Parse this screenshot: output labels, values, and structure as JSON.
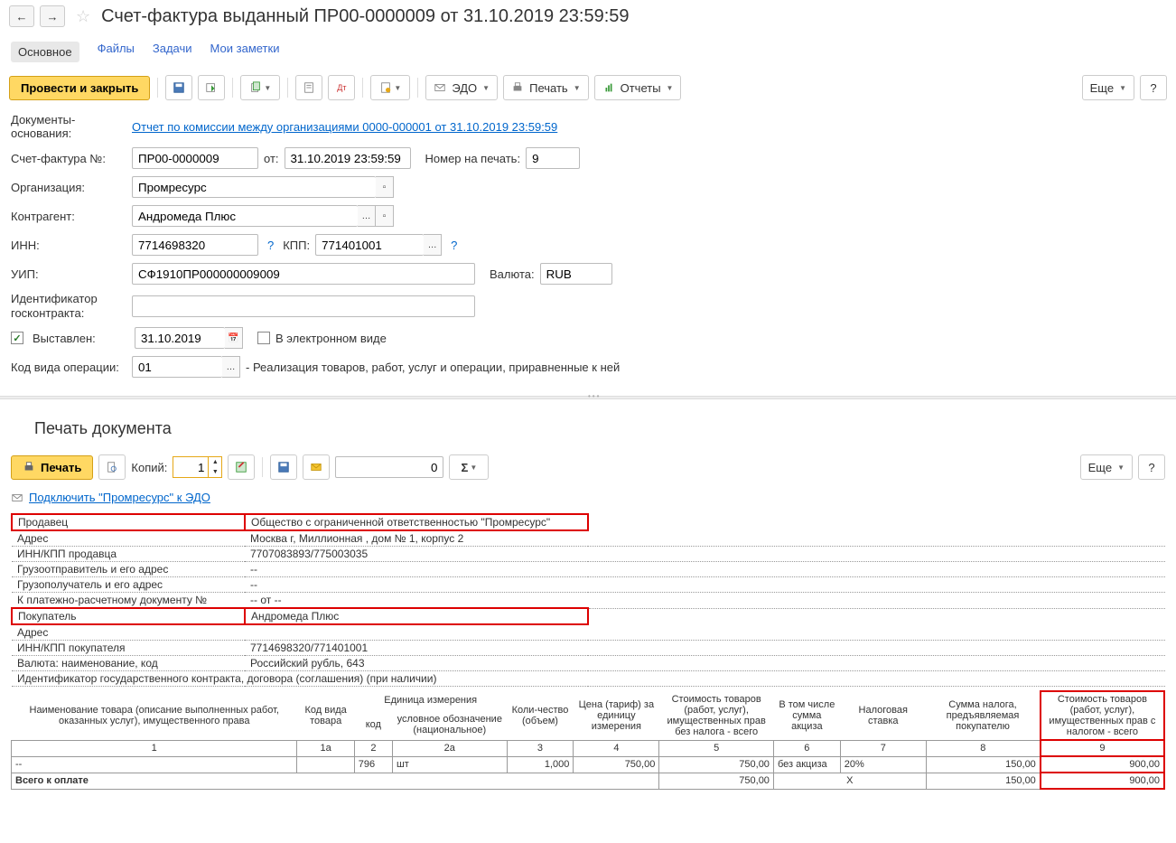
{
  "header": {
    "title": "Счет-фактура выданный ПР00-0000009 от 31.10.2019 23:59:59"
  },
  "tabs": {
    "main": "Основное",
    "files": "Файлы",
    "tasks": "Задачи",
    "notes": "Мои заметки"
  },
  "toolbar": {
    "post_close": "Провести и закрыть",
    "edo": "ЭДО",
    "print": "Печать",
    "reports": "Отчеты",
    "more": "Еще"
  },
  "form": {
    "basis_label": "Документы-основания:",
    "basis_link": "Отчет по комиссии между организациями 0000-000001 от 31.10.2019 23:59:59",
    "invoice_num_label": "Счет-фактура №:",
    "invoice_num": "ПР00-0000009",
    "from_label": "от:",
    "invoice_date": "31.10.2019 23:59:59",
    "print_num_label": "Номер на печать:",
    "print_num": "9",
    "org_label": "Организация:",
    "org": "Промресурс",
    "contractor_label": "Контрагент:",
    "contractor": "Андромеда Плюс",
    "inn_label": "ИНН:",
    "inn": "7714698320",
    "kpp_label": "КПП:",
    "kpp": "771401001",
    "uip_label": "УИП:",
    "uip": "СФ1910ПР000000009009",
    "currency_label": "Валюта:",
    "currency": "RUB",
    "contract_id_label": "Идентификатор госконтракта:",
    "issued_label": "Выставлен:",
    "issued_date": "31.10.2019",
    "electronic_label": "В электронном виде",
    "op_code_label": "Код вида операции:",
    "op_code": "01",
    "op_desc": "- Реализация товаров, работ, услуг и операции, приравненные к ней"
  },
  "print": {
    "title": "Печать документа",
    "print_btn": "Печать",
    "copies_label": "Копий:",
    "copies": "1",
    "sum_field": "0",
    "more": "Еще",
    "edo_link": "Подключить \"Промресурс\" к ЭДО"
  },
  "doc": {
    "seller_label": "Продавец",
    "seller": "Общество с ограниченной ответственностью \"Промресурс\"",
    "address_label": "Адрес",
    "address": "Москва г, Миллионная , дом № 1, корпус 2",
    "seller_inn_label": "ИНН/КПП продавца",
    "seller_inn": "7707083893/775003035",
    "shipper_label": "Грузоотправитель и его адрес",
    "shipper": "--",
    "consignee_label": "Грузополучатель и его адрес",
    "consignee": "--",
    "payment_label": "К платежно-расчетному документу №",
    "payment": "-- от --",
    "buyer_label": "Покупатель",
    "buyer": "Андромеда Плюс",
    "buyer_addr_label": "Адрес",
    "buyer_addr": "",
    "buyer_inn_label": "ИНН/КПП покупателя",
    "buyer_inn": "7714698320/771401001",
    "currency_label": "Валюта: наименование, код",
    "currency": "Российский рубль, 643",
    "contract_label": "Идентификатор государственного контракта, договора (соглашения) (при наличии)"
  },
  "table": {
    "h1": "Наименование товара (описание выполненных работ, оказанных услуг), имущественного права",
    "h1a": "Код вида товара",
    "h_unit": "Единица измерения",
    "h2": "код",
    "h2a": "условное обозначение (национальное)",
    "h3": "Коли-чество (объем)",
    "h4": "Цена (тариф) за единицу измерения",
    "h5": "Стоимость товаров (работ, услуг), имущественных прав без налога - всего",
    "h6": "В том числе сумма акциза",
    "h7": "Налоговая ставка",
    "h8": "Сумма налога, предъявляемая покупателю",
    "h9": "Стоимость товаров (работ, услуг), имущественных прав с налогом - всего",
    "n1": "1",
    "n1a": "1а",
    "n2": "2",
    "n2a": "2а",
    "n3": "3",
    "n4": "4",
    "n5": "5",
    "n6": "6",
    "n7": "7",
    "n8": "8",
    "n9": "9",
    "row": {
      "name": "--",
      "code": "",
      "unit_code": "796",
      "unit_name": "шт",
      "qty": "1,000",
      "price": "750,00",
      "sum_wo_tax": "750,00",
      "excise": "без акциза",
      "rate": "20%",
      "tax": "150,00",
      "total": "900,00"
    },
    "total_label": "Всего к оплате",
    "total_wo_tax": "750,00",
    "total_x": "Х",
    "total_tax": "150,00",
    "total_with_tax": "900,00"
  }
}
